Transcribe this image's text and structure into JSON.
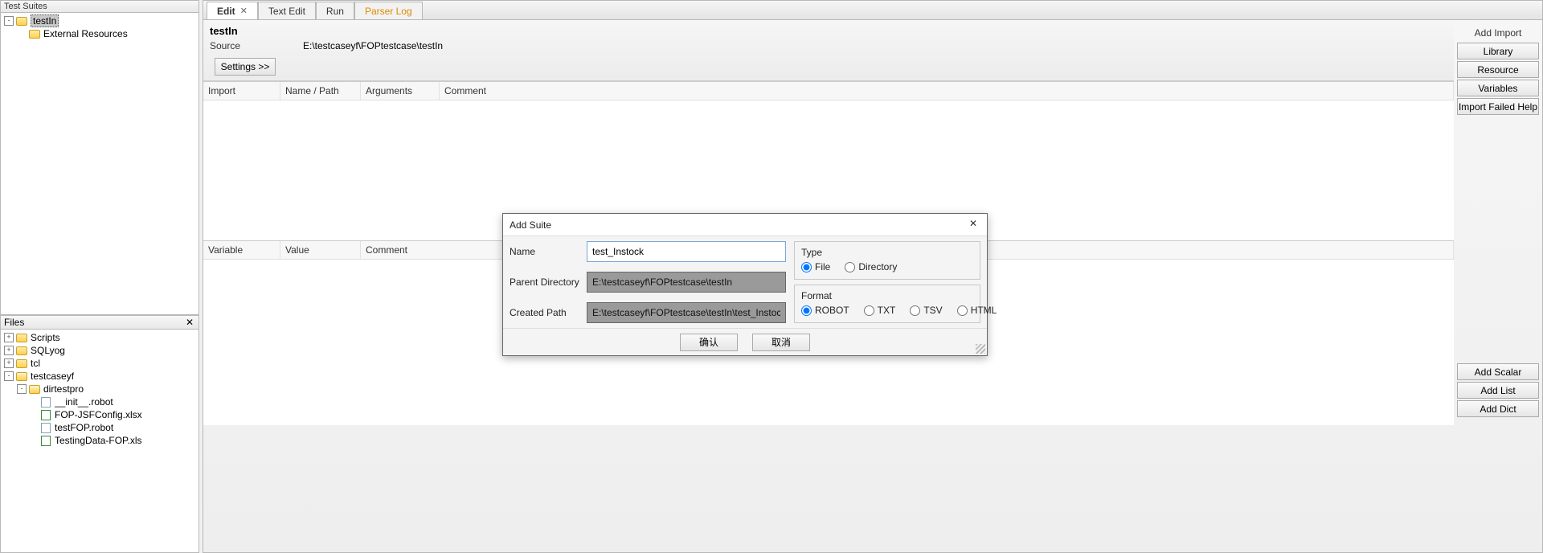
{
  "left": {
    "suites_title": "Test Suites",
    "suite_tree": [
      {
        "label": "testIn",
        "icon": "folder",
        "selected": true,
        "exp": "-",
        "indent": 0
      },
      {
        "label": "External Resources",
        "icon": "folder",
        "selected": false,
        "exp": "",
        "indent": 1
      }
    ],
    "files_title": "Files",
    "files_tree": [
      {
        "label": "Scripts",
        "icon": "folder",
        "exp": "+",
        "indent": 0
      },
      {
        "label": "SQLyog",
        "icon": "folder",
        "exp": "+",
        "indent": 0
      },
      {
        "label": "tcl",
        "icon": "folder",
        "exp": "+",
        "indent": 0
      },
      {
        "label": "testcaseyf",
        "icon": "folder-o",
        "exp": "-",
        "indent": 0
      },
      {
        "label": "dirtestpro",
        "icon": "folder-o",
        "exp": "-",
        "indent": 1
      },
      {
        "label": "__init__.robot",
        "icon": "file",
        "exp": "",
        "indent": 2
      },
      {
        "label": "FOP-JSFConfig.xlsx",
        "icon": "xls",
        "exp": "",
        "indent": 2
      },
      {
        "label": "testFOP.robot",
        "icon": "file",
        "exp": "",
        "indent": 2
      },
      {
        "label": "TestingData-FOP.xls",
        "icon": "xls",
        "exp": "",
        "indent": 2
      }
    ]
  },
  "tabs": {
    "items": [
      {
        "label": "Edit",
        "active": true,
        "closable": true
      },
      {
        "label": "Text Edit",
        "active": false,
        "closable": false
      },
      {
        "label": "Run",
        "active": false,
        "closable": false
      },
      {
        "label": "Parser Log",
        "active": false,
        "closable": false,
        "parser": true
      }
    ]
  },
  "editor": {
    "title": "testIn",
    "source_label": "Source",
    "source_value": "E:\\testcaseyf\\FOPtestcase\\testIn",
    "settings_btn": "Settings >>",
    "import_cols": {
      "import": "Import",
      "name": "Name / Path",
      "args": "Arguments",
      "comment": "Comment"
    },
    "var_cols": {
      "var": "Variable",
      "val": "Value",
      "comment": "Comment"
    },
    "side": {
      "add_import": "Add Import",
      "library": "Library",
      "resource": "Resource",
      "variables": "Variables",
      "import_help": "Import Failed Help",
      "add_scalar": "Add Scalar",
      "add_list": "Add List",
      "add_dict": "Add Dict"
    }
  },
  "dialog": {
    "title": "Add Suite",
    "name_label": "Name",
    "name_value": "test_Instock",
    "parent_label": "Parent Directory",
    "parent_value": "E:\\testcaseyf\\FOPtestcase\\testIn",
    "created_label": "Created Path",
    "created_value": "E:\\testcaseyf\\FOPtestcase\\testIn\\test_Instock.robot",
    "type_label": "Type",
    "type_file": "File",
    "type_dir": "Directory",
    "format_label": "Format",
    "fmt_robot": "ROBOT",
    "fmt_txt": "TXT",
    "fmt_tsv": "TSV",
    "fmt_html": "HTML",
    "ok": "确认",
    "cancel": "取消"
  }
}
